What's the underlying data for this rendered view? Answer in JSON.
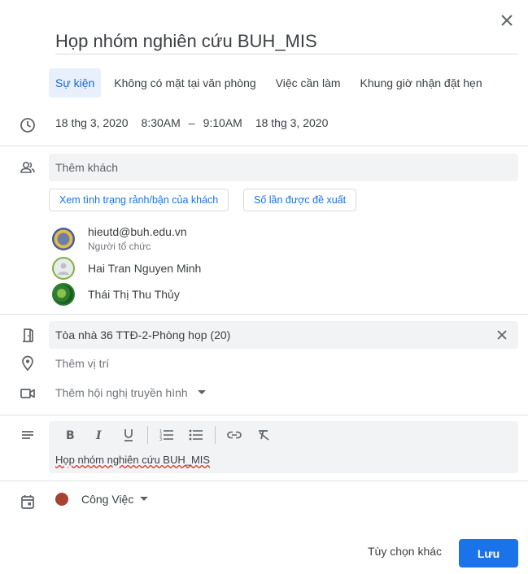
{
  "event": {
    "title": "Họp nhóm nghiên cứu BUH_MIS"
  },
  "tabs": [
    {
      "label": "Sự kiện"
    },
    {
      "label": "Không có mặt tại văn phòng"
    },
    {
      "label": "Việc cần làm"
    },
    {
      "label": "Khung giờ nhận đặt hẹn"
    }
  ],
  "datetime": {
    "start_date": "18 thg 3, 2020",
    "start_time": "8:30AM",
    "separator": "–",
    "end_time": "9:10AM",
    "end_date": "18 thg 3, 2020"
  },
  "guests_section": {
    "input_placeholder": "Thêm khách",
    "availability_button": "Xem tình trạng rảnh/bận của khách",
    "suggested_times_button": "Số lần được đề xuất",
    "guests": [
      {
        "name": "hieutd@buh.edu.vn",
        "role": "Người tổ chức"
      },
      {
        "name": "Hai Tran Nguyen Minh"
      },
      {
        "name": "Thái Thị Thu Thủy"
      }
    ]
  },
  "room": {
    "value": "Tòa nhà 36 TTĐ-2-Phòng họp (20)"
  },
  "location": {
    "placeholder": "Thêm vị trí"
  },
  "conference": {
    "label": "Thêm hội nghị truyền hình"
  },
  "description": {
    "text": "Họp nhóm nghiên cứu BUH_MIS"
  },
  "calendar": {
    "name": "Công Việc",
    "color": "#a74232"
  },
  "footer": {
    "more_options": "Tùy chọn khác",
    "save": "Lưu"
  },
  "colors": {
    "accent": "#1a73e8",
    "tab_active_bg": "#e8f0fe",
    "field_bg": "#f1f3f4"
  }
}
